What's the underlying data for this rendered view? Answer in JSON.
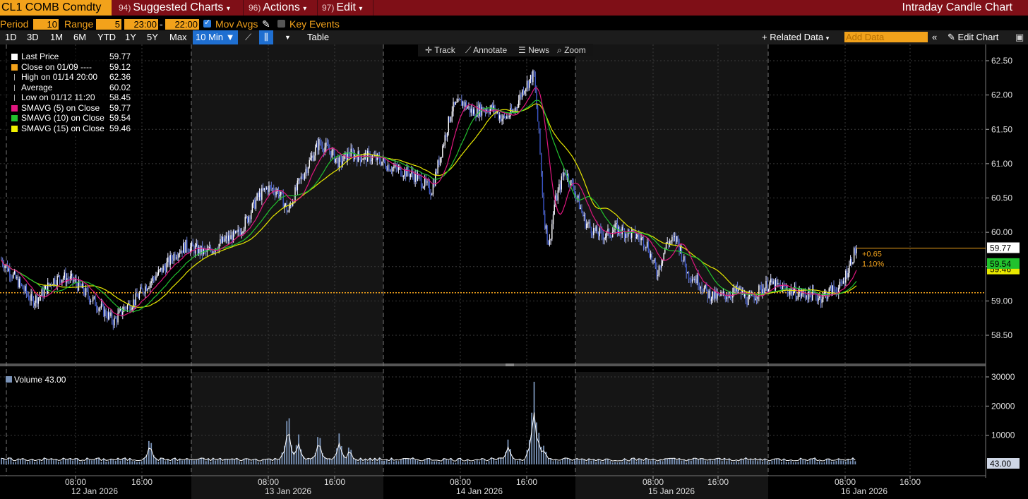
{
  "topbar": {
    "ticker": "CL1 COMB Comdty",
    "menus": [
      {
        "num": "94)",
        "label": "Suggested Charts"
      },
      {
        "num": "96)",
        "label": "Actions"
      },
      {
        "num": "97)",
        "label": "Edit"
      }
    ],
    "title": "Intraday Candle Chart"
  },
  "settings": {
    "period_label": "Period",
    "period_value": "10",
    "range_label": "Range",
    "range_value": "5",
    "time_start": "23:00",
    "time_end": "22:00",
    "mov_avgs": "Mov Avgs",
    "key_events": "Key Events"
  },
  "range_buttons": [
    "1D",
    "3D",
    "1M",
    "6M",
    "YTD",
    "1Y",
    "5Y",
    "Max"
  ],
  "interval": "10 Min",
  "table_btn": "Table",
  "related_data": "+ Related Data",
  "add_data_placeholder": "Add Data",
  "edit_chart": "Edit Chart",
  "tools": {
    "track": "Track",
    "annotate": "Annotate",
    "news": "News",
    "zoom": "Zoom"
  },
  "legend": [
    {
      "label": "Last Price",
      "value": "59.77",
      "color": "#ffffff"
    },
    {
      "label": "Close on 01/09 ----",
      "value": "59.12",
      "color": "#f2a21b"
    },
    {
      "label": "High on 01/14 20:00",
      "value": "62.36",
      "color": "#cccccc"
    },
    {
      "label": "Average",
      "value": "60.02",
      "color": "#cccccc"
    },
    {
      "label": "Low on 01/12 11:20",
      "value": "58.45",
      "color": "#cccccc"
    },
    {
      "label": "SMAVG (5)  on Close",
      "value": "59.77",
      "color": "#e0167f"
    },
    {
      "label": "SMAVG (10)  on Close",
      "value": "59.54",
      "color": "#22c22e"
    },
    {
      "label": "SMAVG (15)  on Close",
      "value": "59.46",
      "color": "#f0f000"
    }
  ],
  "volume_legend": {
    "label": "Volume",
    "value": "43.00"
  },
  "price_tags": {
    "last": "59.77",
    "sma10": "59.54",
    "sma15": "59.46",
    "vol": "43.00",
    "change": "+0.65",
    "change_pct": "1.10%"
  },
  "chart_data": {
    "type": "candlestick",
    "title": "Intraday Candle Chart",
    "interval": "10 Min",
    "y_ticks": [
      58.5,
      59.0,
      59.5,
      60.0,
      60.5,
      61.0,
      61.5,
      62.0,
      62.5
    ],
    "y_tick_labels": [
      "58.50",
      "59.00",
      "59.50",
      "60.00",
      "60.50",
      "61.00",
      "61.50",
      "62.00",
      "62.50"
    ],
    "ylim": [
      58.1,
      62.75
    ],
    "prev_close": 59.12,
    "last_price": 59.77,
    "vol_ticks": [
      10000,
      20000,
      30000
    ],
    "vol_tick_labels": [
      "10000",
      "20000",
      "30000"
    ],
    "vol_lim": [
      0,
      31000
    ],
    "x_time_labels": [
      "08:00",
      "16:00",
      "08:00",
      "16:00",
      "08:00",
      "16:00",
      "08:00",
      "16:00",
      "08:00",
      "16:00"
    ],
    "x_date_labels": [
      "12 Jan 2026",
      "13 Jan 2026",
      "14 Jan 2026",
      "15 Jan 2026",
      "16 Jan 2026"
    ],
    "price_path": [
      [
        0,
        59.6
      ],
      [
        2,
        59.4
      ],
      [
        4,
        59.2
      ],
      [
        6,
        59.0
      ],
      [
        8,
        59.1
      ],
      [
        10,
        59.3
      ],
      [
        12,
        59.35
      ],
      [
        14,
        59.3
      ],
      [
        16,
        59.15
      ],
      [
        18,
        59.0
      ],
      [
        20,
        58.85
      ],
      [
        22,
        58.7
      ],
      [
        24,
        58.9
      ],
      [
        26,
        59.0
      ],
      [
        28,
        59.2
      ],
      [
        30,
        59.35
      ],
      [
        32,
        59.5
      ],
      [
        34,
        59.7
      ],
      [
        36,
        59.8
      ],
      [
        38,
        59.75
      ],
      [
        40,
        59.7
      ],
      [
        42,
        59.8
      ],
      [
        44,
        59.9
      ],
      [
        46,
        59.95
      ],
      [
        48,
        60.2
      ],
      [
        50,
        60.5
      ],
      [
        52,
        60.65
      ],
      [
        54,
        60.6
      ],
      [
        56,
        60.3
      ],
      [
        58,
        60.7
      ],
      [
        60,
        61.0
      ],
      [
        62,
        61.3
      ],
      [
        64,
        61.2
      ],
      [
        66,
        61.0
      ],
      [
        68,
        61.15
      ],
      [
        70,
        61.1
      ],
      [
        72,
        61.1
      ],
      [
        74,
        61.05
      ],
      [
        76,
        60.95
      ],
      [
        78,
        60.9
      ],
      [
        80,
        60.85
      ],
      [
        82,
        60.75
      ],
      [
        84,
        60.6
      ],
      [
        86,
        61.2
      ],
      [
        88,
        61.8
      ],
      [
        90,
        61.9
      ],
      [
        92,
        61.75
      ],
      [
        94,
        61.8
      ],
      [
        96,
        61.8
      ],
      [
        98,
        61.65
      ],
      [
        100,
        61.75
      ],
      [
        102,
        62.1
      ],
      [
        104,
        62.3
      ],
      [
        105,
        61.4
      ],
      [
        106,
        60.2
      ],
      [
        107,
        59.8
      ],
      [
        108,
        60.4
      ],
      [
        110,
        60.9
      ],
      [
        112,
        60.6
      ],
      [
        114,
        60.15
      ],
      [
        116,
        60.0
      ],
      [
        118,
        59.95
      ],
      [
        120,
        60.05
      ],
      [
        122,
        60.0
      ],
      [
        124,
        59.95
      ],
      [
        126,
        59.85
      ],
      [
        128,
        59.4
      ],
      [
        130,
        59.85
      ],
      [
        132,
        59.9
      ],
      [
        134,
        59.4
      ],
      [
        136,
        59.3
      ],
      [
        138,
        59.1
      ],
      [
        140,
        59.05
      ],
      [
        142,
        59.1
      ],
      [
        144,
        59.15
      ],
      [
        146,
        59.0
      ],
      [
        148,
        59.15
      ],
      [
        150,
        59.25
      ],
      [
        152,
        59.2
      ],
      [
        154,
        59.15
      ],
      [
        156,
        59.1
      ],
      [
        158,
        59.1
      ],
      [
        160,
        59.05
      ],
      [
        162,
        59.15
      ],
      [
        164,
        59.2
      ],
      [
        166,
        59.6
      ],
      [
        167,
        59.77
      ]
    ],
    "volume_spikes": [
      [
        29,
        10000
      ],
      [
        56,
        20000
      ],
      [
        58,
        11000
      ],
      [
        62,
        12000
      ],
      [
        66,
        11000
      ],
      [
        68,
        7000
      ],
      [
        99,
        9000
      ],
      [
        104,
        30000
      ],
      [
        105,
        11000
      ],
      [
        106,
        7000
      ]
    ]
  }
}
